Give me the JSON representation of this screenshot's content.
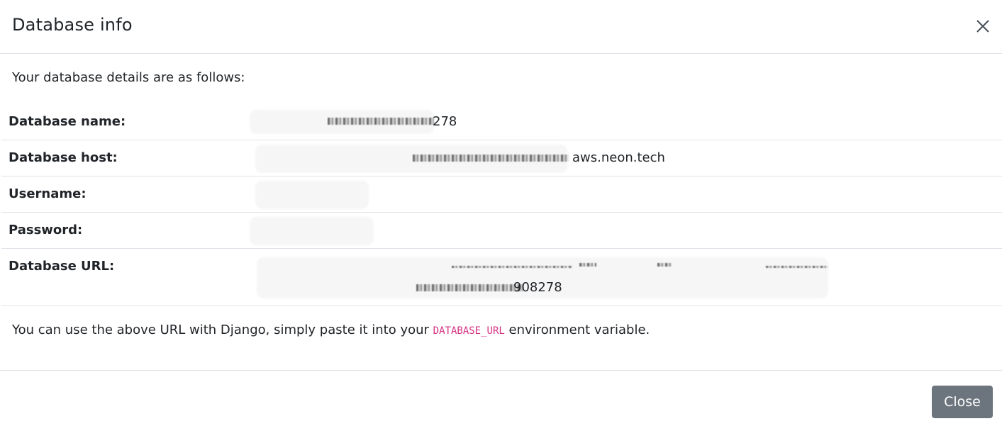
{
  "dialog": {
    "title": "Database info",
    "close_icon": "close-icon",
    "intro": "Your database details are as follows:",
    "rows": [
      {
        "label": "Database name:",
        "value": "278"
      },
      {
        "label": "Database host:",
        "value": "aws.neon.tech"
      },
      {
        "label": "Username:",
        "value": ""
      },
      {
        "label": "Password:",
        "value": ""
      },
      {
        "label": "Database URL:",
        "value": "908278"
      }
    ],
    "footer_before": "You can use the above URL with Django, simply paste it into your ",
    "footer_code": "DATABASE_URL",
    "footer_after": " environment variable.",
    "close_button": "Close"
  },
  "colors": {
    "code": "#d63384",
    "button_bg": "#6c757d",
    "border": "#dee2e6"
  }
}
